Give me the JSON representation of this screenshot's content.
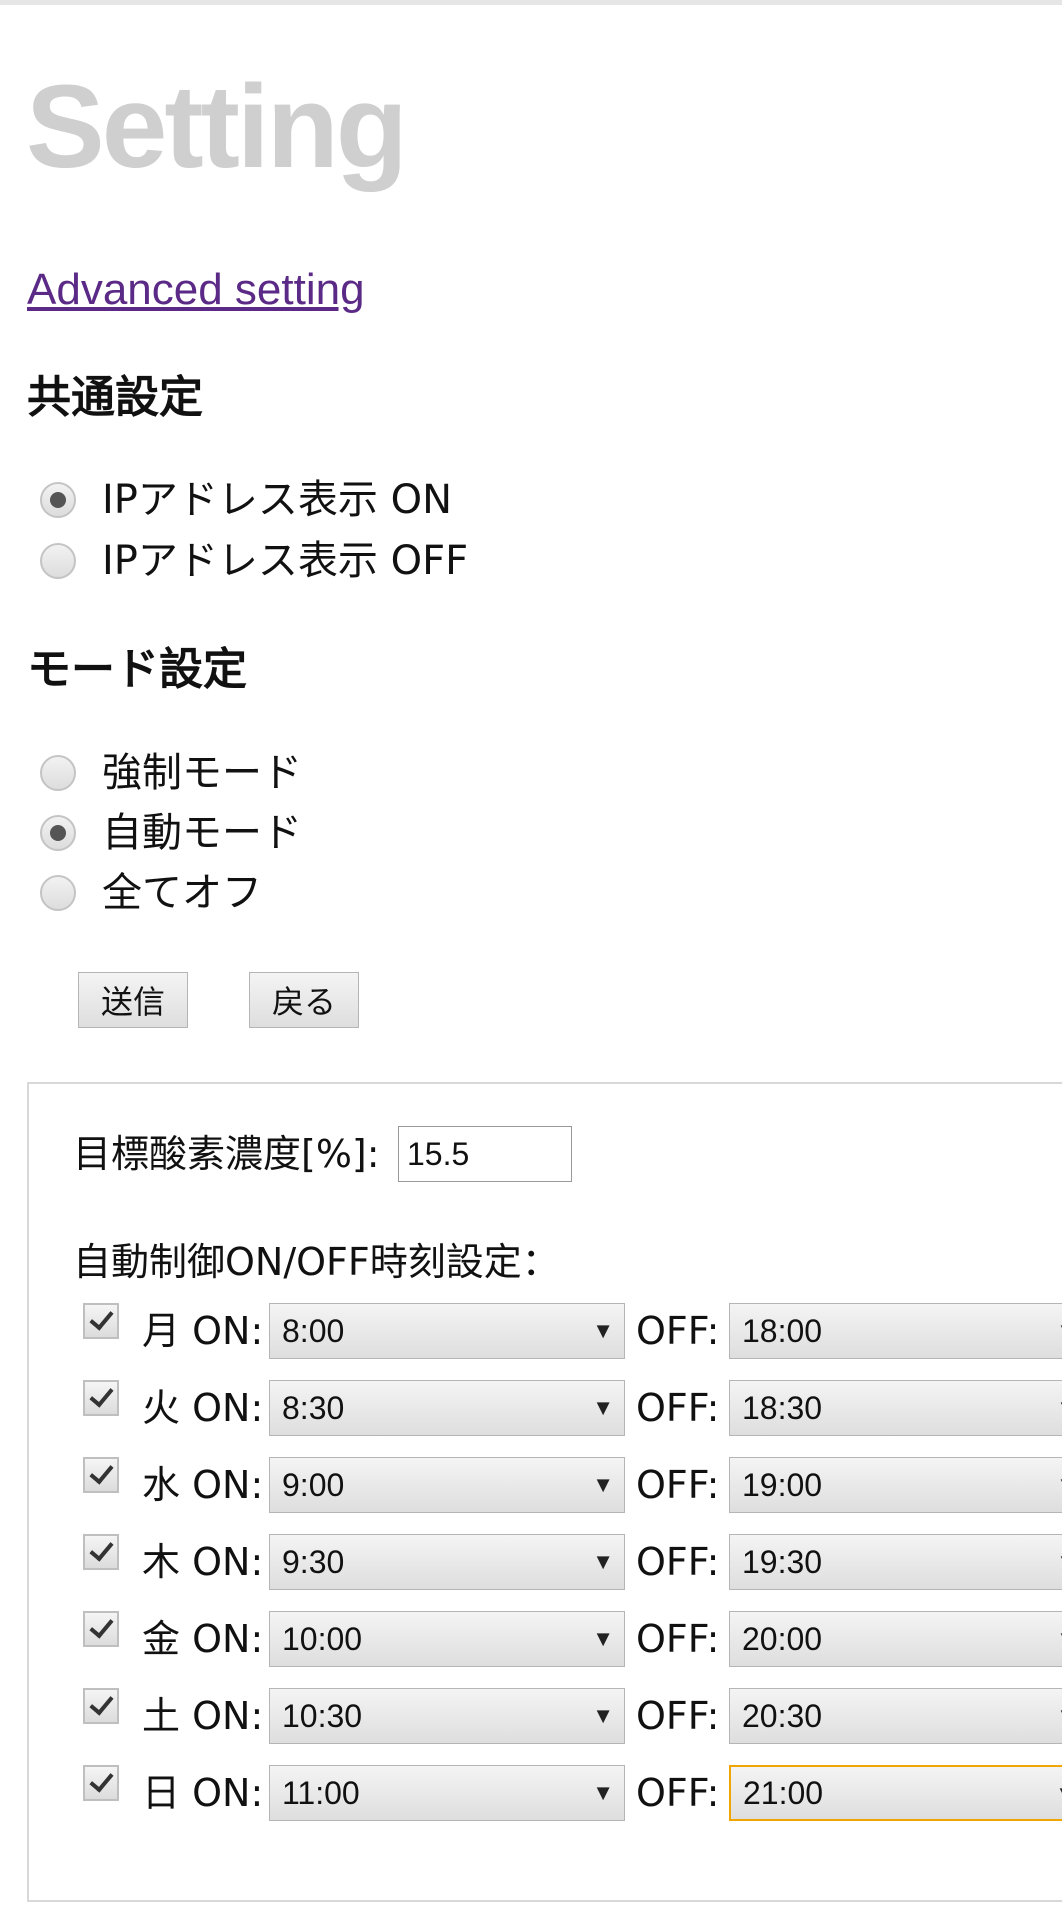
{
  "page": {
    "title": "Setting",
    "advanced_link": "Advanced setting"
  },
  "common": {
    "heading": "共通設定",
    "options": [
      {
        "label": "IPアドレス表示 ON",
        "checked": true
      },
      {
        "label": "IPアドレス表示 OFF",
        "checked": false
      }
    ]
  },
  "mode": {
    "heading": "モード設定",
    "options": [
      {
        "label": "強制モード",
        "checked": false
      },
      {
        "label": "自動モード",
        "checked": true
      },
      {
        "label": "全てオフ",
        "checked": false
      }
    ]
  },
  "buttons": {
    "send": "送信",
    "back": "戻る"
  },
  "oxygen": {
    "label": "目標酸素濃度[%]:",
    "value": "15.5"
  },
  "schedule": {
    "label": "自動制御ON/OFF時刻設定：",
    "on_suffix": "ON:",
    "off_label": "OFF:",
    "arrow": "▼",
    "days": [
      {
        "day": "月",
        "on": "8:00",
        "off": "18:00",
        "enabled": true
      },
      {
        "day": "火",
        "on": "8:30",
        "off": "18:30",
        "enabled": true
      },
      {
        "day": "水",
        "on": "9:00",
        "off": "19:00",
        "enabled": true
      },
      {
        "day": "木",
        "on": "9:30",
        "off": "19:30",
        "enabled": true
      },
      {
        "day": "金",
        "on": "10:00",
        "off": "20:00",
        "enabled": true
      },
      {
        "day": "土",
        "on": "10:30",
        "off": "20:30",
        "enabled": true
      },
      {
        "day": "日",
        "on": "11:00",
        "off": "21:00",
        "enabled": true
      }
    ]
  },
  "colors": {
    "title": "#cfcfcf",
    "link": "#5b2a86",
    "focus": "#f0a500"
  }
}
